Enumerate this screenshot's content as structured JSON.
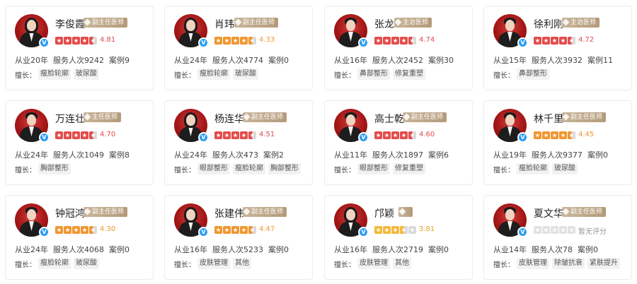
{
  "cards": [
    {
      "name": "李俊霞",
      "title": "副主任医师",
      "rating": 4.81,
      "score": "4.81",
      "star_color": "#e34b4b",
      "years": "从业20年",
      "services": "服务人次9242",
      "cases": "案例9",
      "skills_label": "擅长：",
      "tags": [
        "瘦脸轮廓",
        "玻尿酸"
      ]
    },
    {
      "name": "肖玮",
      "title": "副主任医师",
      "rating": 4.33,
      "score": "4.33",
      "star_color": "#f0962f",
      "years": "从业24年",
      "services": "服务人次4774",
      "cases": "案例0",
      "skills_label": "擅长：",
      "tags": [
        "瘦脸轮廓",
        "玻尿酸"
      ]
    },
    {
      "name": "张龙",
      "title": "主治医师",
      "rating": 4.74,
      "score": "4.74",
      "star_color": "#e34b4b",
      "years": "从业16年",
      "services": "服务人次2452",
      "cases": "案例30",
      "skills_label": "擅长：",
      "tags": [
        "鼻部整形",
        "修复重塑"
      ]
    },
    {
      "name": "徐利刚",
      "title": "主治医师",
      "rating": 4.72,
      "score": "4.72",
      "star_color": "#e34b4b",
      "years": "从业15年",
      "services": "服务人次3932",
      "cases": "案例11",
      "skills_label": "擅长：",
      "tags": [
        "鼻部整形"
      ]
    },
    {
      "name": "万连壮",
      "title": "主任医师",
      "rating": 4.7,
      "score": "4.70",
      "star_color": "#e34b4b",
      "years": "从业24年",
      "services": "服务人次1049",
      "cases": "案例8",
      "skills_label": "擅长：",
      "tags": [
        "胸部整形"
      ]
    },
    {
      "name": "杨连华",
      "title": "副主任医师",
      "rating": 4.51,
      "score": "4.51",
      "star_color": "#e34b4b",
      "years": "从业24年",
      "services": "服务人次473",
      "cases": "案例2",
      "skills_label": "擅长：",
      "tags": [
        "眼部整形",
        "瘦脸轮廓",
        "胸部整形"
      ]
    },
    {
      "name": "高士乾",
      "title": "副主任医师",
      "rating": 4.6,
      "score": "4.60",
      "star_color": "#e34b4b",
      "years": "从业11年",
      "services": "服务人次1897",
      "cases": "案例6",
      "skills_label": "擅长：",
      "tags": [
        "眼部整形",
        "修复重塑"
      ]
    },
    {
      "name": "林千里",
      "title": "副主任医师",
      "rating": 4.45,
      "score": "4.45",
      "star_color": "#f0962f",
      "years": "从业19年",
      "services": "服务人次9377",
      "cases": "案例0",
      "skills_label": "擅长：",
      "tags": [
        "瘦脸轮廓",
        "玻尿酸"
      ]
    },
    {
      "name": "钟冠鸿",
      "title": "副主任医师",
      "rating": 4.3,
      "score": "4.30",
      "star_color": "#f0962f",
      "years": "从业24年",
      "services": "服务人次4068",
      "cases": "案例0",
      "skills_label": "擅长：",
      "tags": [
        "瘦脸轮廓",
        "玻尿酸"
      ]
    },
    {
      "name": "张建伟",
      "title": "副主任医师",
      "rating": 4.47,
      "score": "4.47",
      "star_color": "#f0962f",
      "years": "从业16年",
      "services": "服务人次5233",
      "cases": "案例0",
      "skills_label": "擅长：",
      "tags": [
        "皮肤管理",
        "其他"
      ]
    },
    {
      "name": "邝颖",
      "title": "",
      "rating": 3.81,
      "score": "3.81",
      "star_color": "#f3b93a",
      "years": "从业16年",
      "services": "服务人次2719",
      "cases": "案例0",
      "skills_label": "擅长：",
      "tags": [
        "皮肤管理",
        "其他"
      ]
    },
    {
      "name": "夏文华",
      "title": "副主任医师",
      "rating": 0,
      "score": "暂无评分",
      "star_color": "#e2e2e2",
      "years": "从业14年",
      "services": "服务人次78",
      "cases": "案例0",
      "skills_label": "擅长：",
      "tags": [
        "皮肤管理",
        "除皱抗衰",
        "紧肤提升"
      ]
    }
  ]
}
